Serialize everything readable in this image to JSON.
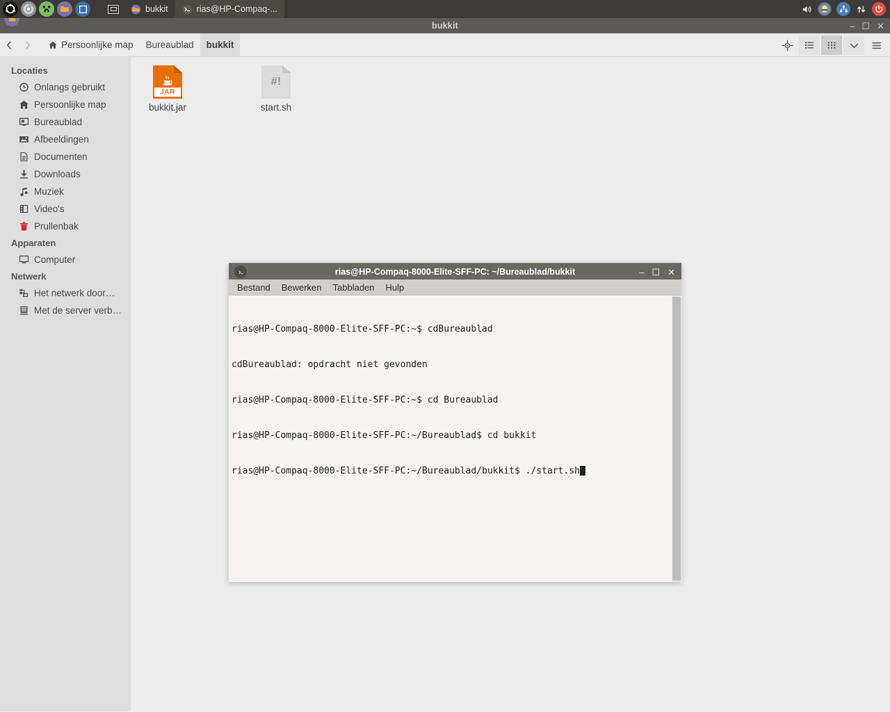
{
  "top_panel": {
    "launchers": [
      {
        "name": "ubuntu-logo-icon",
        "label": "Ubuntu"
      },
      {
        "name": "chromium-icon",
        "label": "Chromium"
      },
      {
        "name": "minecraft-creeper-icon",
        "label": "Minecraft"
      },
      {
        "name": "files-icon",
        "label": "Bestanden"
      },
      {
        "name": "window-icon",
        "label": "Venster"
      }
    ],
    "show_desktop_label": "Bureaublad tonen",
    "tasks": [
      {
        "label": "bukkit",
        "icon": "folder-icon",
        "active": false
      },
      {
        "label": "rias@HP-Compaq-...",
        "icon": "terminal-icon",
        "active": true
      }
    ],
    "tray": [
      {
        "name": "volume-icon",
        "label": "Volume"
      },
      {
        "name": "user-account-icon",
        "label": "rias"
      },
      {
        "name": "network-icon",
        "label": "Netwerk"
      },
      {
        "name": "updown-arrows-icon",
        "label": "Netwerkverkeer"
      },
      {
        "name": "power-icon",
        "label": "Afsluiten"
      }
    ]
  },
  "file_manager": {
    "title": "bukkit",
    "window_buttons": {
      "minimize": "–",
      "maximize": "☐",
      "close": "✕"
    },
    "nav": {
      "back": "‹",
      "forward": "›"
    },
    "breadcrumbs": [
      {
        "label": "Persoonlijke map",
        "icon": "home-icon",
        "current": false
      },
      {
        "label": "Bureaublad",
        "icon": "",
        "current": false
      },
      {
        "label": "bukkit",
        "icon": "",
        "current": true
      }
    ],
    "toolbar_right": [
      {
        "name": "location-target-icon",
        "label": "Locatie",
        "state": "normal"
      },
      {
        "name": "list-view-icon",
        "label": "Lijstweergave",
        "state": "grouped"
      },
      {
        "name": "grid-view-icon",
        "label": "Pictogramweergave",
        "state": "toggled"
      },
      {
        "name": "chevron-down-icon",
        "label": "Weergaveopties",
        "state": "grouped"
      },
      {
        "name": "hamburger-menu-icon",
        "label": "Menu",
        "state": "normal"
      }
    ],
    "sidebar": {
      "sections": [
        {
          "heading": "Locaties",
          "items": [
            {
              "label": "Onlangs gebruikt",
              "icon": "clock-icon"
            },
            {
              "label": "Persoonlijke map",
              "icon": "home-icon"
            },
            {
              "label": "Bureaublad",
              "icon": "desktop-icon"
            },
            {
              "label": "Afbeeldingen",
              "icon": "image-icon"
            },
            {
              "label": "Documenten",
              "icon": "document-icon"
            },
            {
              "label": "Downloads",
              "icon": "download-icon"
            },
            {
              "label": "Muziek",
              "icon": "music-note-icon"
            },
            {
              "label": "Video's",
              "icon": "film-icon"
            },
            {
              "label": "Prullenbak",
              "icon": "trash-icon"
            }
          ]
        },
        {
          "heading": "Apparaten",
          "items": [
            {
              "label": "Computer",
              "icon": "monitor-icon"
            }
          ]
        },
        {
          "heading": "Netwerk",
          "items": [
            {
              "label": "Het netwerk door…",
              "icon": "network-browse-icon"
            },
            {
              "label": "Met de server verb…",
              "icon": "server-icon"
            }
          ]
        }
      ]
    },
    "files": [
      {
        "label": "bukkit.jar",
        "type": "jar",
        "badge": "JAR"
      },
      {
        "label": "start.sh",
        "type": "script",
        "badge": "#!"
      }
    ]
  },
  "terminal": {
    "title": "rias@HP-Compaq-8000-Elite-SFF-PC: ~/Bureaublad/bukkit",
    "window_buttons": {
      "minimize": "–",
      "maximize": "☐",
      "close": "✕"
    },
    "menus": [
      "Bestand",
      "Bewerken",
      "Tabbladen",
      "Hulp"
    ],
    "lines": [
      "rias@HP-Compaq-8000-Elite-SFF-PC:~$ cdBureaublad",
      "cdBureaublad: opdracht niet gevonden",
      "rias@HP-Compaq-8000-Elite-SFF-PC:~$ cd Bureaublad",
      "rias@HP-Compaq-8000-Elite-SFF-PC:~/Bureaublad$ cd bukkit",
      "rias@HP-Compaq-8000-Elite-SFF-PC:~/Bureaublad/bukkit$ ./start.sh"
    ]
  },
  "colors": {
    "panel_bg": "#3c3b37",
    "fm_titlebar": "#5c5b57",
    "sidebar_bg": "#dedede",
    "content_bg": "#ececec",
    "term_titlebar": "#6a6862",
    "term_bg": "#f7f3f2",
    "jar_orange": "#e8700a",
    "power_red": "#e04a3f"
  }
}
